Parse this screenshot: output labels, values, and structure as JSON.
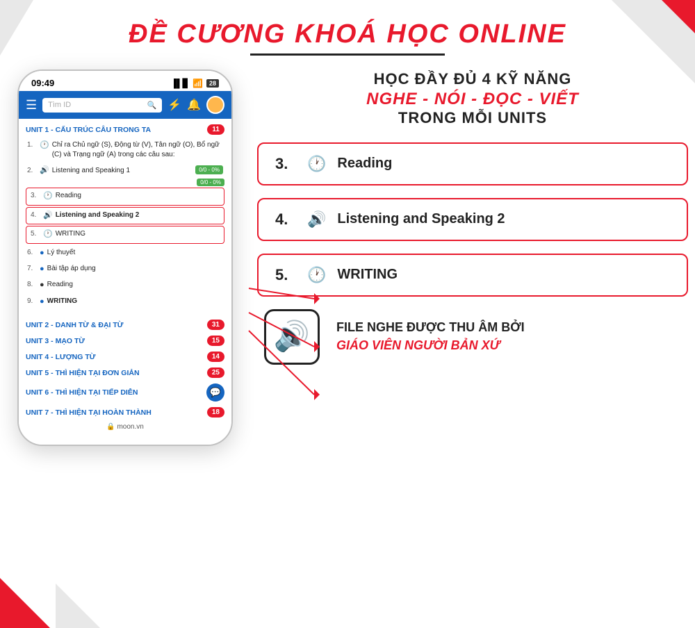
{
  "page": {
    "title": "ĐỀ CƯƠNG KHOÁ HỌC ONLINE",
    "title_underline": true
  },
  "decorative": {
    "shapes": [
      "top-right-gray",
      "top-right-red",
      "bottom-left-red",
      "bottom-left-gray",
      "top-left-gray"
    ]
  },
  "phone": {
    "status_bar": {
      "time": "09:49",
      "signal": "📶",
      "wifi": "WiFi",
      "battery": "28"
    },
    "header": {
      "search_placeholder": "Tìm ID",
      "hamburger": "☰"
    },
    "unit1": {
      "title": "UNIT 1 - CẤU TRÚC CÂU TRONG TA",
      "badge": "11",
      "lessons": [
        {
          "num": "1.",
          "icon": "🕐",
          "text": "Chỉ ra Chủ ngữ (S), Động từ (V), Tân ngữ (O), Bổ ngữ (C) và Trạng ngữ (A) trong các câu sau:",
          "progress": null,
          "highlighted": false
        },
        {
          "num": "2.",
          "icon": "🔊",
          "text": "Listening and Speaking 1",
          "progress": "0/0 - 0%",
          "highlighted": false
        },
        {
          "num": "3.",
          "icon": "🕐",
          "text": "Reading",
          "progress": null,
          "highlighted": true
        },
        {
          "num": "4.",
          "icon": "🔊",
          "text": "Listening and Speaking 2",
          "progress": null,
          "highlighted": true
        },
        {
          "num": "5.",
          "icon": "🕐",
          "text": "WRITING",
          "progress": null,
          "highlighted": true
        },
        {
          "num": "6.",
          "icon": "🔵",
          "text": "Lý thuyết",
          "progress": null,
          "highlighted": false
        },
        {
          "num": "7.",
          "icon": "🔵",
          "text": "Bài tập áp dụng",
          "progress": null,
          "highlighted": false
        },
        {
          "num": "8.",
          "icon": "⚫",
          "text": "Reading",
          "progress": null,
          "highlighted": false
        },
        {
          "num": "9.",
          "icon": "🔵",
          "text": "WRITING",
          "progress": null,
          "highlighted": false
        }
      ]
    },
    "other_units": [
      {
        "title": "UNIT 2 - DANH TỪ & ĐẠI TỪ",
        "badge": "31"
      },
      {
        "title": "UNIT 3 - MẠO TỪ",
        "badge": "15"
      },
      {
        "title": "UNIT 4 - LƯỢNG TỪ",
        "badge": "14"
      },
      {
        "title": "UNIT 5 - THÌ HIỆN TẠI ĐƠN GIẢN",
        "badge": "25"
      },
      {
        "title": "UNIT 6 - THÌ HIỆN TẠI TIẾP DIỄN",
        "badge": ""
      },
      {
        "title": "UNIT 7 - THÌ HIỆN TẠI HOÀN THÀNH",
        "badge": "18"
      }
    ],
    "footer": "moon.vn"
  },
  "right": {
    "skills_line1": "HỌC ĐẦY ĐỦ 4 KỸ NĂNG",
    "skills_line2": "NGHE - NÓI - ĐỌC - VIẾT",
    "skills_line3": "TRONG MỖI UNITS",
    "skill_cards": [
      {
        "num": "3.",
        "icon": "🕐",
        "label": "Reading"
      },
      {
        "num": "4.",
        "icon": "🔊",
        "label": "Listening and Speaking 2"
      },
      {
        "num": "5.",
        "icon": "🕐",
        "label": "WRITING"
      }
    ],
    "audio_icon": "🔊",
    "audio_text_line1": "FILE NGHE ĐƯỢC THU ÂM BỞI",
    "audio_text_line2": "GIÁO VIÊN NGƯỜI BẢN XỨ"
  },
  "colors": {
    "red": "#e8192c",
    "blue": "#1565c0",
    "dark": "#222222",
    "gray": "#e8e8e8"
  }
}
